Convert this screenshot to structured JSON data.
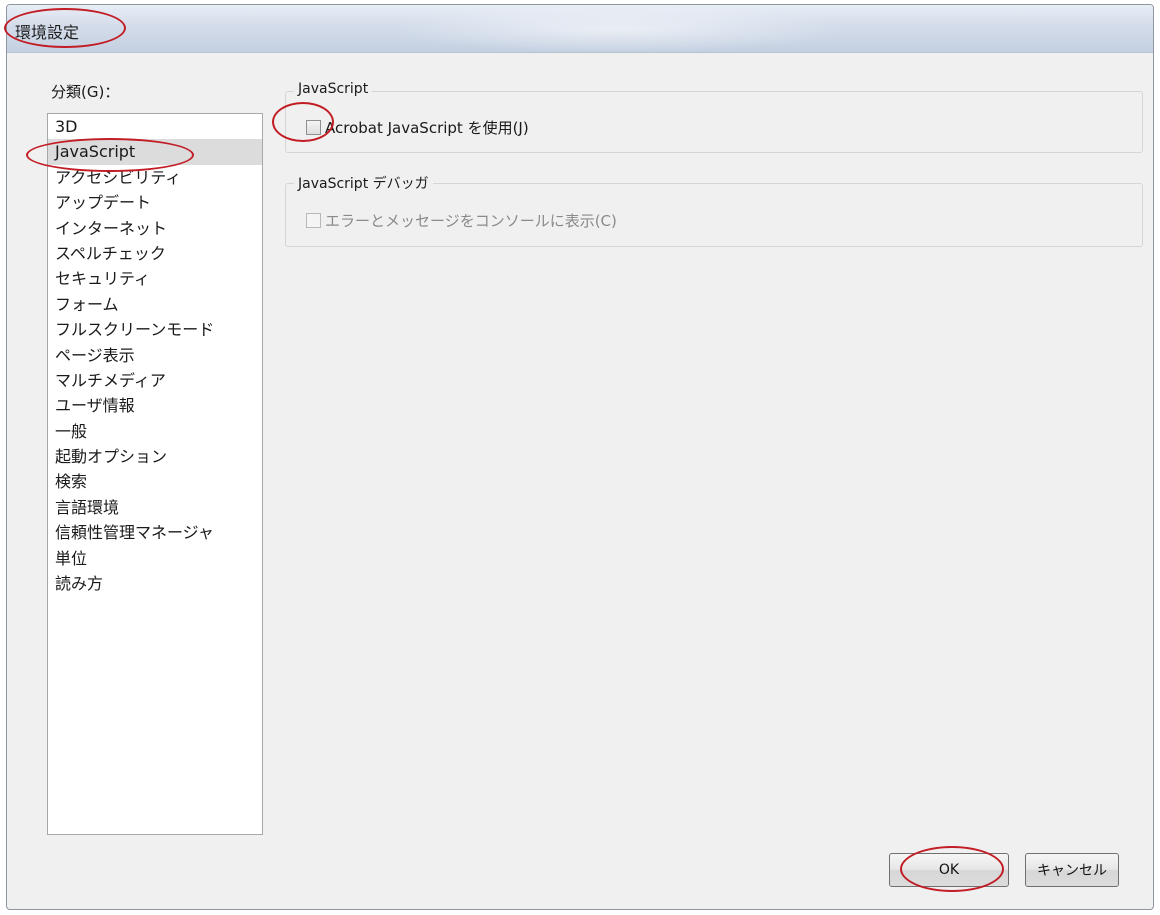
{
  "window": {
    "title": "環境設定"
  },
  "sidebar": {
    "label": "分類(G)：",
    "selected": "JavaScript",
    "items": [
      "3D",
      "JavaScript",
      "アクセシビリティ",
      "アップデート",
      "インターネット",
      "スペルチェック",
      "セキュリティ",
      "フォーム",
      "フルスクリーンモード",
      "ページ表示",
      "マルチメディア",
      "ユーザ情報",
      "一般",
      "起動オプション",
      "検索",
      "言語環境",
      "信頼性管理マネージャ",
      "単位",
      "読み方"
    ]
  },
  "main": {
    "javascript_group": {
      "title": "JavaScript",
      "enable_checkbox": {
        "label": "Acrobat JavaScript を使用(J)",
        "checked": false,
        "enabled": true
      }
    },
    "debugger_group": {
      "title": "JavaScript デバッガ",
      "console_checkbox": {
        "label": "エラーとメッセージをコンソールに表示(C)",
        "checked": false,
        "enabled": false
      }
    }
  },
  "footer": {
    "ok_label": "OK",
    "cancel_label": "キャンセル"
  },
  "colors": {
    "annotation": "#c21d24",
    "dialog_background": "#f0f0f0",
    "selected_item": "#dcdcdc"
  }
}
